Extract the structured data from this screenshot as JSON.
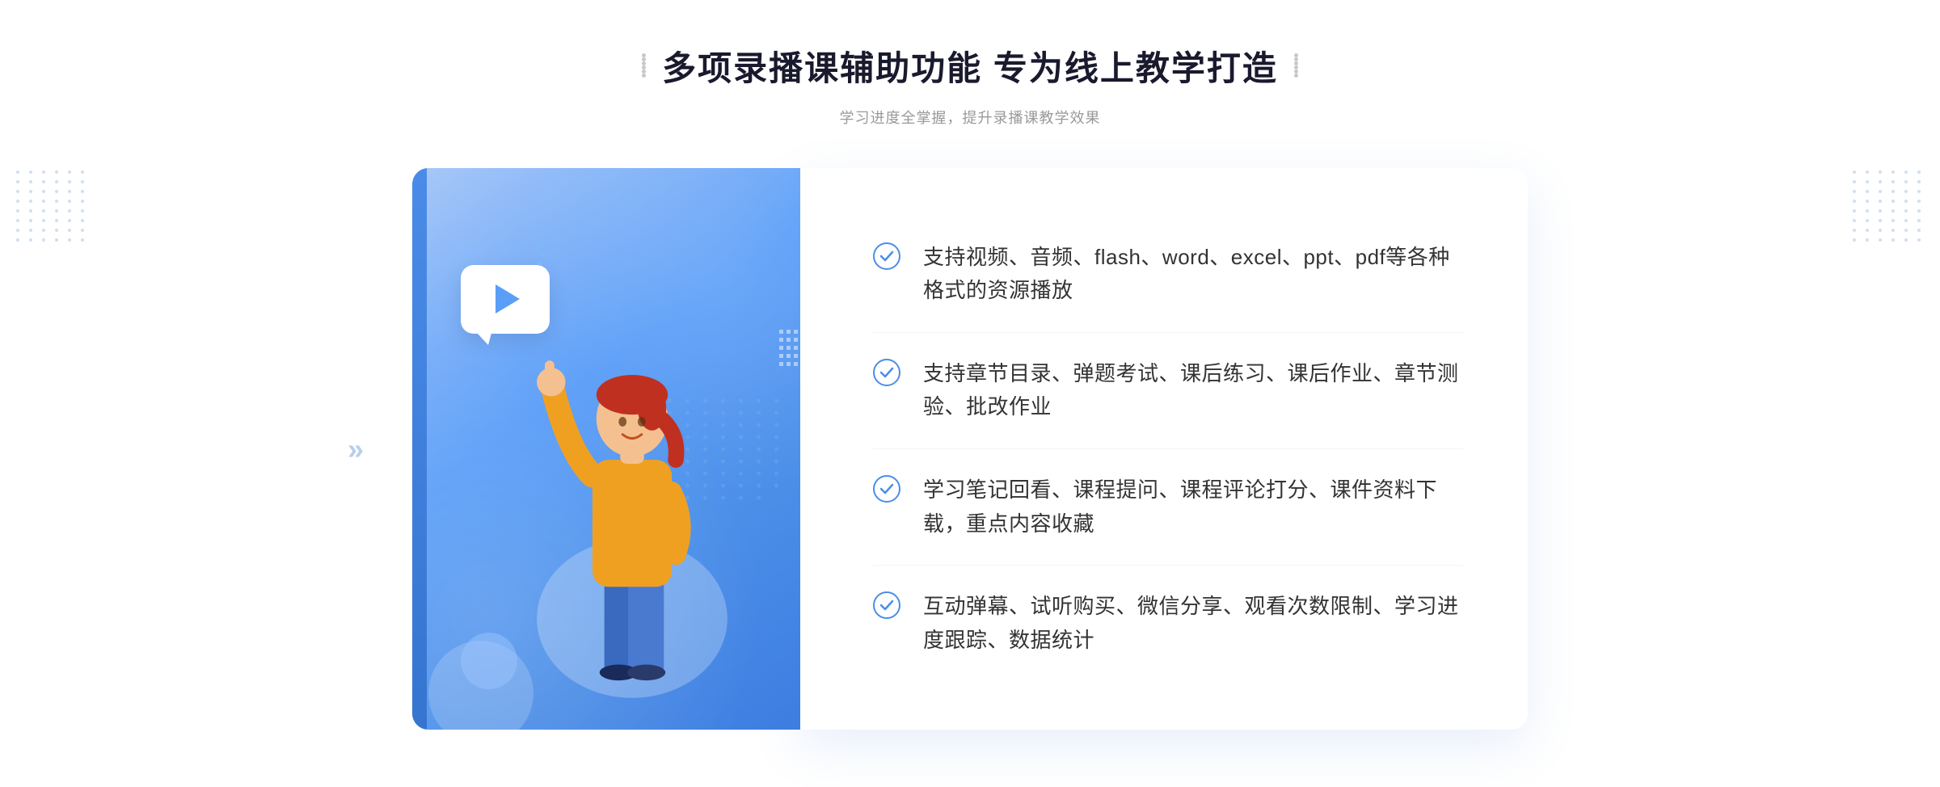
{
  "header": {
    "title": "多项录播课辅助功能 专为线上教学打造",
    "subtitle": "学习进度全掌握，提升录播课教学效果",
    "title_decoration_left": "decorative-dots",
    "title_decoration_right": "decorative-dots"
  },
  "features": [
    {
      "id": 1,
      "text": "支持视频、音频、flash、word、excel、ppt、pdf等各种格式的资源播放"
    },
    {
      "id": 2,
      "text": "支持章节目录、弹题考试、课后练习、课后作业、章节测验、批改作业"
    },
    {
      "id": 3,
      "text": "学习笔记回看、课程提问、课程评论打分、课件资料下载，重点内容收藏"
    },
    {
      "id": 4,
      "text": "互动弹幕、试听购买、微信分享、观看次数限制、学习进度跟踪、数据统计"
    }
  ],
  "illustration": {
    "play_button": "▶",
    "left_arrows": "»"
  },
  "colors": {
    "accent": "#4a8ee8",
    "text_primary": "#333333",
    "text_secondary": "#999999",
    "card_bg": "#ffffff",
    "gradient_start": "#a8c8f8",
    "gradient_end": "#3d7de0"
  }
}
